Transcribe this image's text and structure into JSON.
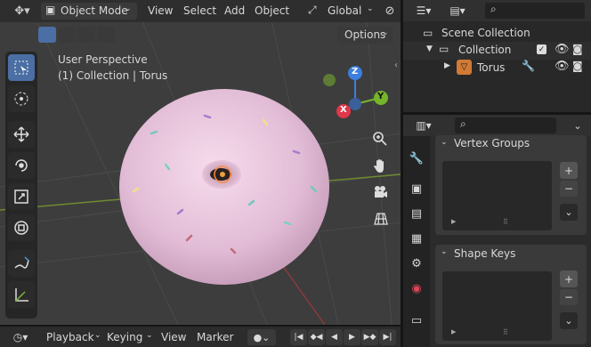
{
  "viewport": {
    "mode": "Object Mode",
    "menus": [
      "View",
      "Select",
      "Add",
      "Object"
    ],
    "transform_orientation": "Global",
    "options_label": "Options",
    "overlay_line1": "User Perspective",
    "overlay_line2": "(1) Collection | Torus",
    "gizmo": {
      "x": "X",
      "y": "Y",
      "z": "Z"
    },
    "tools": [
      "select-box-icon",
      "cursor-icon",
      "move-icon",
      "rotate-icon",
      "scale-icon",
      "transform-icon",
      "annotate-icon",
      "measure-icon"
    ],
    "nav": [
      "zoom-icon",
      "hand-pan-icon",
      "camera-icon",
      "grid-icon"
    ]
  },
  "outliner": {
    "scene_collection": "Scene Collection",
    "collection": "Collection",
    "object": "Torus"
  },
  "properties": {
    "vertex_groups": "Vertex Groups",
    "shape_keys": "Shape Keys",
    "tabs": [
      "tool-icon",
      "render-icon",
      "output-icon",
      "view-layer-icon",
      "scene-icon",
      "world-icon",
      "collection-icon"
    ]
  },
  "timeline": {
    "menus": [
      "Playback",
      "Keying",
      "View",
      "Marker"
    ]
  },
  "colors": {
    "accent_blue": "#4b6ea4",
    "axis_x": "#e0364b",
    "axis_y": "#75b52a",
    "axis_z": "#3b7fe0",
    "donut_icing": "#e8c4dc"
  }
}
